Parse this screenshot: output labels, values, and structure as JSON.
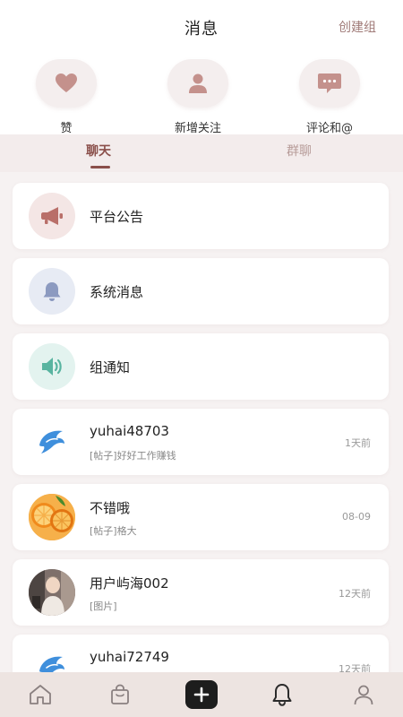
{
  "header": {
    "title": "消息",
    "create_group": "创建组"
  },
  "quick_actions": [
    {
      "label": "赞",
      "icon": "heart-icon"
    },
    {
      "label": "新增关注",
      "icon": "user-icon"
    },
    {
      "label": "评论和@",
      "icon": "comment-icon"
    }
  ],
  "tabs": {
    "chat": "聊天",
    "group": "群聊",
    "active": "chat"
  },
  "conversations": [
    {
      "name": "平台公告",
      "icon": "megaphone-icon"
    },
    {
      "name": "系统消息",
      "icon": "bell-icon"
    },
    {
      "name": "组通知",
      "icon": "speaker-icon"
    },
    {
      "name": "yuhai48703",
      "preview": "[帖子]好好工作赚钱",
      "time": "1天前",
      "icon": "dolphin-avatar"
    },
    {
      "name": "不错哦",
      "preview": "[帖子]格大",
      "time": "08-09",
      "icon": "orange-avatar"
    },
    {
      "name": "用户屿海002",
      "preview": "[图片]",
      "time": "12天前",
      "icon": "photo-avatar"
    },
    {
      "name": "yuhai72749",
      "preview": "",
      "time": "12天前",
      "icon": "dolphin-avatar"
    }
  ],
  "bottom_nav": [
    {
      "icon": "home-icon"
    },
    {
      "icon": "bag-icon"
    },
    {
      "icon": "plus-icon"
    },
    {
      "icon": "bell-icon"
    },
    {
      "icon": "profile-icon"
    }
  ],
  "colors": {
    "accent": "#8a4f4a",
    "background": "#f6f2f2",
    "nav_background": "#ede4e1"
  }
}
